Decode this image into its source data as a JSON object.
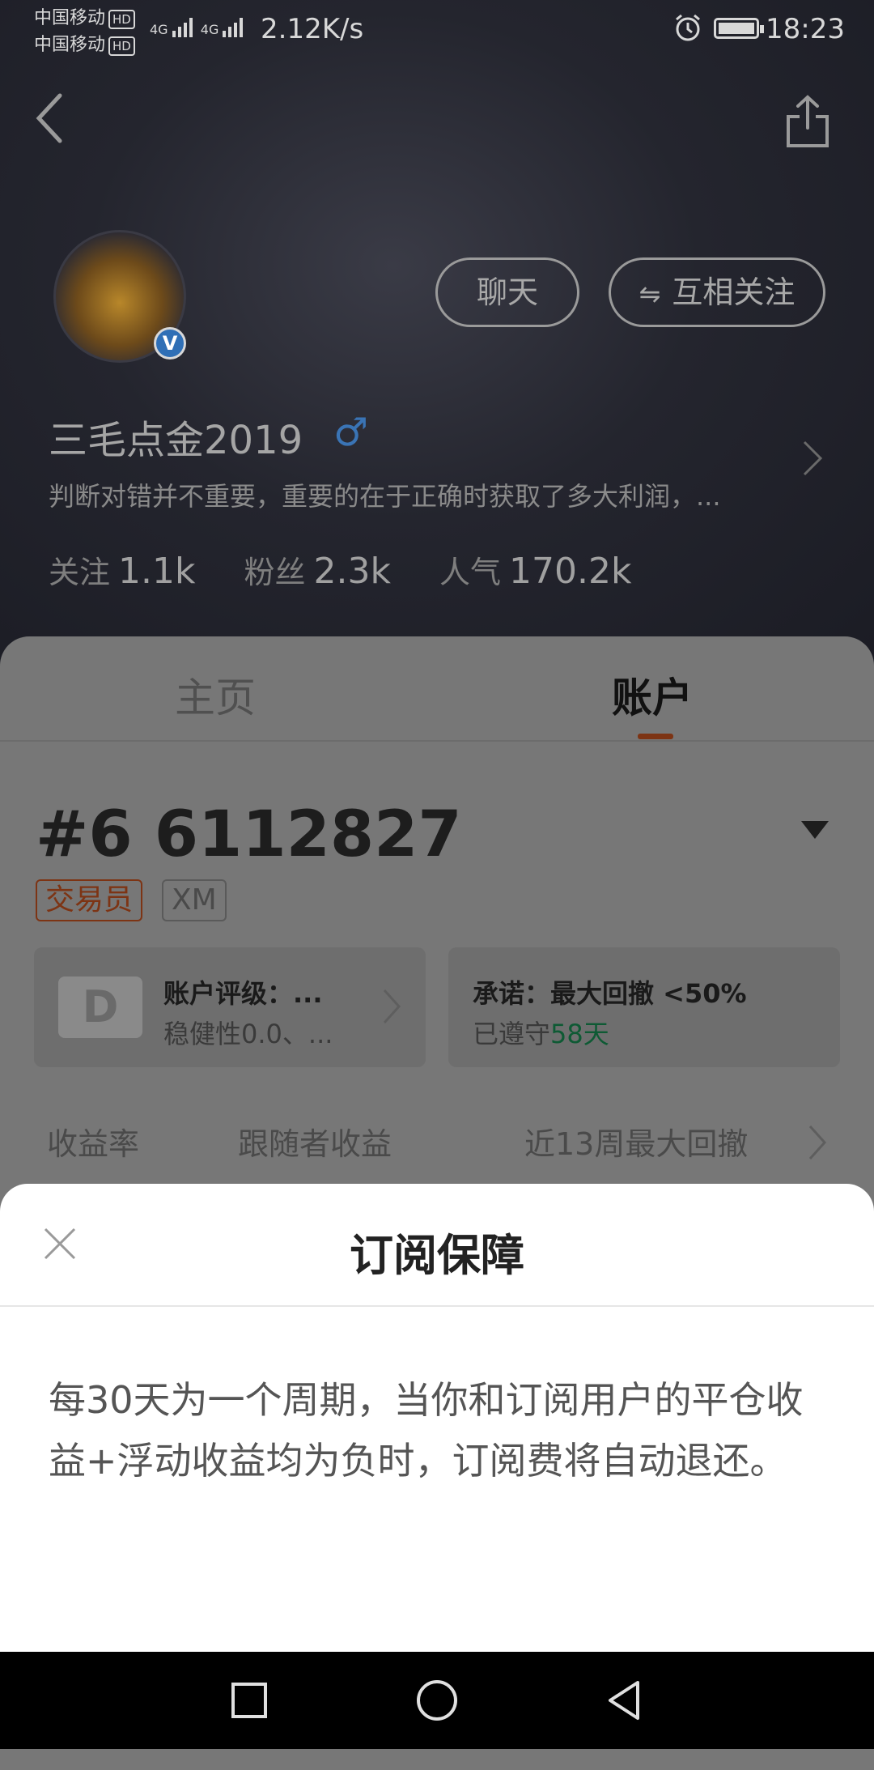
{
  "status_bar": {
    "carrier_1": "中国移动",
    "carrier_2": "中国移动",
    "hd_label": "HD",
    "network": "4G",
    "speed": "2.12K/s",
    "time": "18:23"
  },
  "profile": {
    "chat_label": "聊天",
    "follow_label": "互相关注",
    "username": "三毛点金2019",
    "gender_symbol": "♂",
    "verified_symbol": "V",
    "bio": "判断对错并不重要，重要的在于正确时获取了多大利润，...",
    "stats": {
      "following_label": "关注",
      "following_value": "1.1k",
      "fans_label": "粉丝",
      "fans_value": "2.3k",
      "popularity_label": "人气",
      "popularity_value": "170.2k"
    }
  },
  "tabs": {
    "home": "主页",
    "account": "账户"
  },
  "account": {
    "number": "#6 6112827",
    "tag_trader": "交易员",
    "tag_broker": "XM",
    "rating_grade": "D",
    "rating_title": "账户评级：...",
    "rating_sub": "稳健性0.0、...",
    "promise_title": "承诺：最大回撤 <50%",
    "promise_sub_prefix": "已遵守",
    "promise_days": "58天",
    "metrics": {
      "return_label": "收益率",
      "follower_label": "跟随者收益",
      "drawdown_label": "近13周最大回撤"
    }
  },
  "sheet": {
    "title": "订阅保障",
    "body": "每30天为一个周期，当你和订阅用户的平仓收益+浮动收益均为负时，订阅费将自动退还。"
  },
  "colors": {
    "accent": "#e8602c",
    "verified": "#2f6fb6",
    "green": "#1aa05a"
  }
}
